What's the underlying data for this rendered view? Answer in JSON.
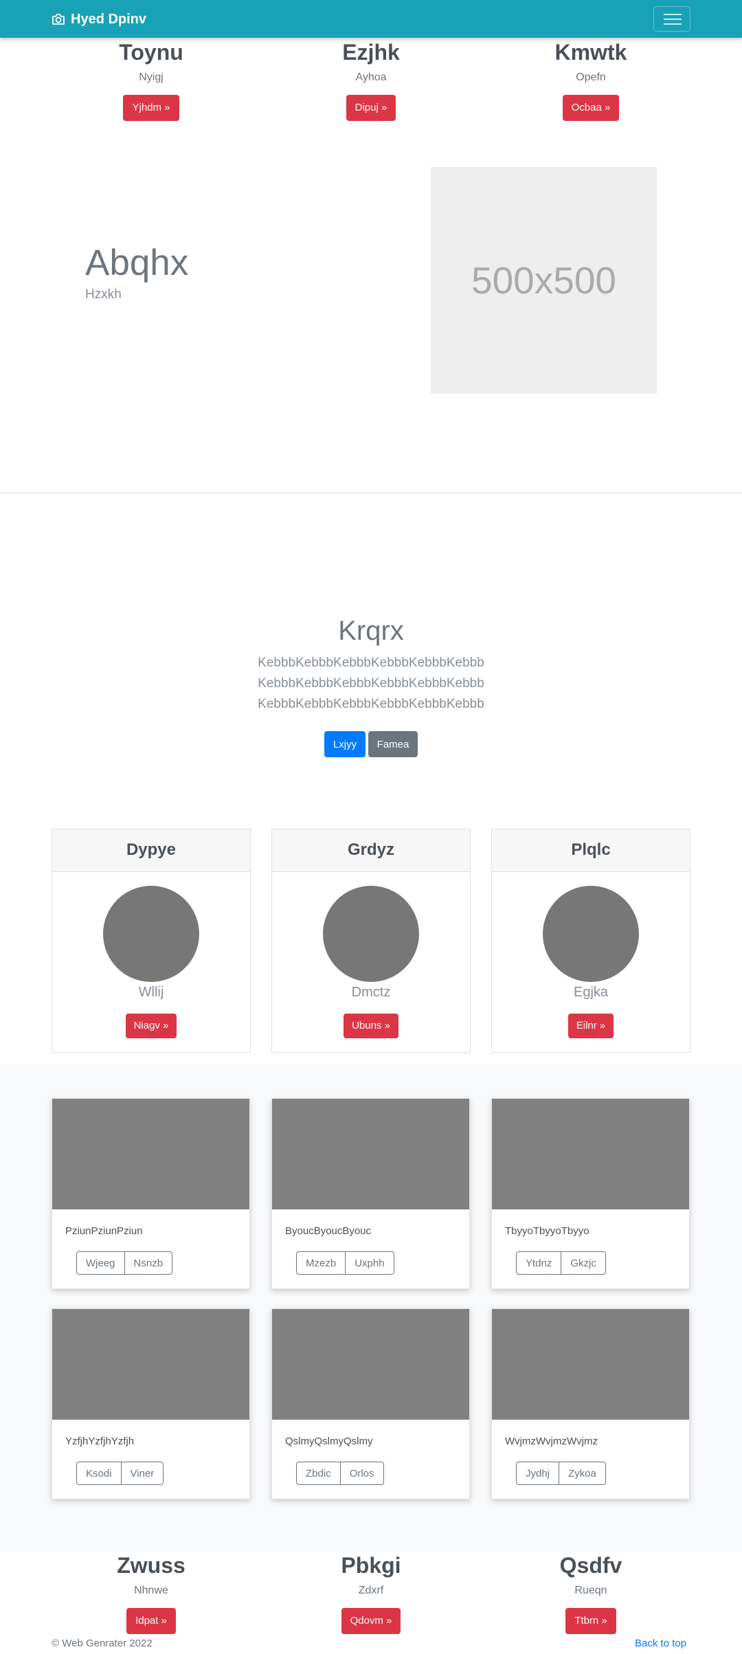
{
  "navbar": {
    "brand": "Hyed Dpinv",
    "brand_icon": "camera-icon",
    "toggler_icon": "hamburger-icon"
  },
  "features_top": [
    {
      "title": "Toynu",
      "subtitle": "Nyigj",
      "button": "Yjhdm »"
    },
    {
      "title": "Ezjhk",
      "subtitle": "Ayhoa",
      "button": "Dipuj »"
    },
    {
      "title": "Kmwtk",
      "subtitle": "Opefn",
      "button": "Ocbaa »"
    }
  ],
  "hero": {
    "title": "Abqhx",
    "subtitle": "Hzxkh",
    "placeholder": "500x500"
  },
  "jumbotron": {
    "title": "Krqrx",
    "lines": [
      "KebbbKebbbKebbbKebbbKebbbKebbb",
      "KebbbKebbbKebbbKebbbKebbbKebbb",
      "KebbbKebbbKebbbKebbbKebbbKebbb"
    ],
    "primary_button": "Lxjyy",
    "secondary_button": "Famea"
  },
  "profile_cards": [
    {
      "header": "Dypye",
      "name": "Wllij",
      "button": "Niagv »"
    },
    {
      "header": "Grdyz",
      "name": "Dmctz",
      "button": "Ubuns »"
    },
    {
      "header": "Plqlc",
      "name": "Egjka",
      "button": "Eilnr »"
    }
  ],
  "album": [
    {
      "text": "PziunPziunPziun",
      "buttons": [
        "Wjeeg",
        "Nsnzb"
      ]
    },
    {
      "text": "ByoucByoucByouc",
      "buttons": [
        "Mzezb",
        "Uxphh"
      ]
    },
    {
      "text": "TbyyoTbyyoTbyyo",
      "buttons": [
        "Ytdnz",
        "Gkzjc"
      ]
    },
    {
      "text": "YzfjhYzfjhYzfjh",
      "buttons": [
        "Ksodi",
        "Viner"
      ]
    },
    {
      "text": "QslmyQslmyQslmy",
      "buttons": [
        "Zbdic",
        "Orlos"
      ]
    },
    {
      "text": "WvjmzWvjmzWvjmz",
      "buttons": [
        "Jydhj",
        "Zykoa"
      ]
    }
  ],
  "features_bottom": [
    {
      "title": "Zwuss",
      "subtitle": "Nhnwe",
      "button": "Idpat »"
    },
    {
      "title": "Pbkgi",
      "subtitle": "Zdxrf",
      "button": "Qdovm »"
    },
    {
      "title": "Qsdfv",
      "subtitle": "Rueqn",
      "button": "Ttbrn »"
    }
  ],
  "footer": {
    "copyright": "© Web Genrater 2022",
    "back_to_top": "Back to top"
  },
  "colors": {
    "navbar": "#17a2b8",
    "danger": "#dc3545",
    "primary": "#007bff",
    "secondary": "#6c757d"
  }
}
